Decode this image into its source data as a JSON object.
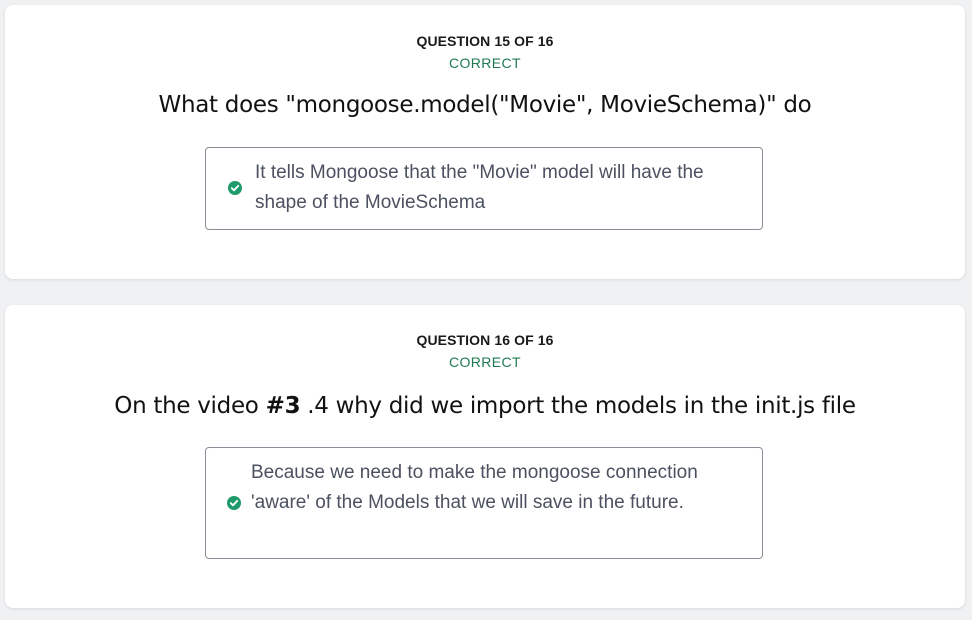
{
  "theme": {
    "correct_color": "#1f7a52",
    "check_color": "#1f9a6a",
    "page_bg": "#f0f1f3"
  },
  "questions": [
    {
      "counter": "QUESTION 15 OF 16",
      "status": "CORRECT",
      "title": "What does \"mongoose.model(\"Movie\", MovieSchema)\" do",
      "answer": {
        "icon": "check-circle-icon",
        "text": "It tells Mongoose that the \"Movie\" model will have the shape of the MovieSchema"
      }
    },
    {
      "counter": "QUESTION 16 OF 16",
      "status": "CORRECT",
      "title_prefix": "On the video ",
      "title_bold": "#3",
      "title_suffix": " .4 why did we import the models in the init.js file",
      "answer": {
        "icon": "check-circle-icon",
        "text": "Because we need to make the mongoose connection 'aware' of the Models that we will save in the future."
      }
    }
  ]
}
